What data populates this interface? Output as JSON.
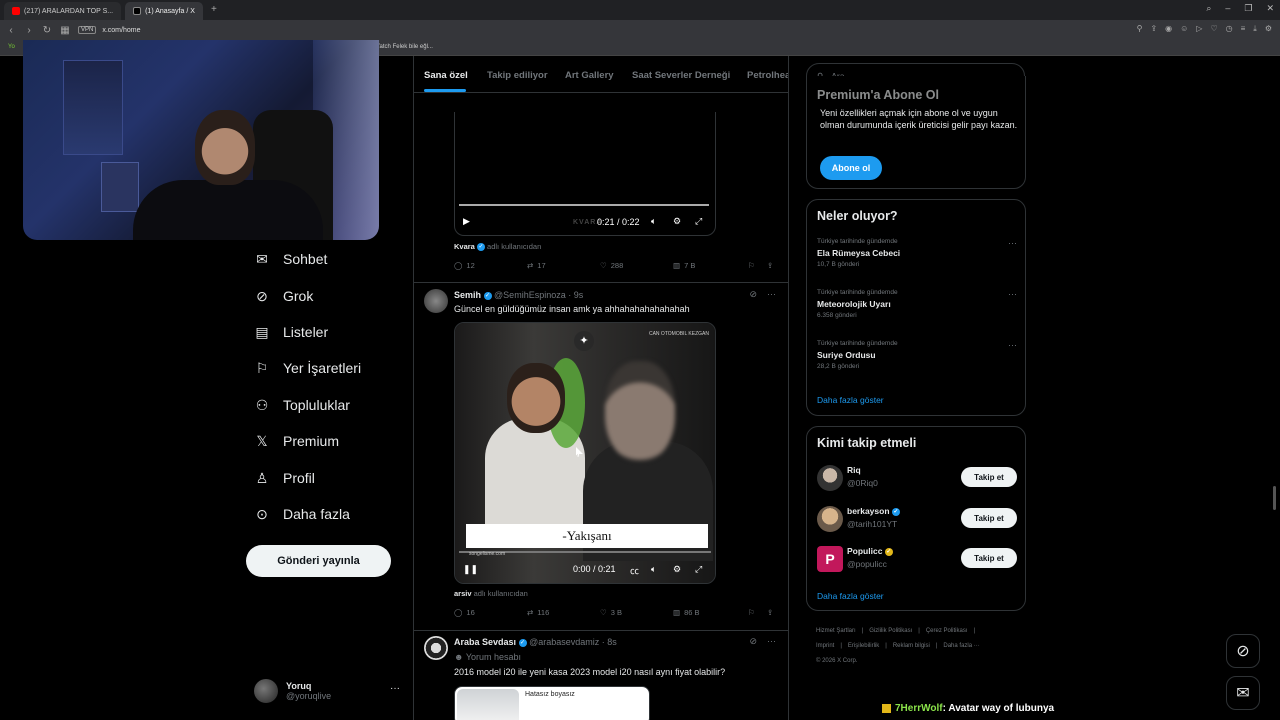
{
  "browser": {
    "tabs": [
      {
        "label": "(217) ARALARDAN TOP S...",
        "active": false
      },
      {
        "label": "(1) Anasayfa / X",
        "active": true
      }
    ],
    "url": "x.com/home",
    "vpn_badge": "VPN",
    "bookmark_left": "Yo",
    "bookmark_right": "Yatch Felek bile eğl..."
  },
  "sidebar": {
    "items": [
      {
        "label": "Sohbet",
        "icon": "mail-icon"
      },
      {
        "label": "Grok",
        "icon": "grok-icon"
      },
      {
        "label": "Listeler",
        "icon": "list-icon"
      },
      {
        "label": "Yer İşaretleri",
        "icon": "bookmark-icon"
      },
      {
        "label": "Topluluklar",
        "icon": "communities-icon"
      },
      {
        "label": "Premium",
        "icon": "x-logo-icon"
      },
      {
        "label": "Profil",
        "icon": "person-icon"
      },
      {
        "label": "Daha fazla",
        "icon": "more-circle-icon"
      }
    ],
    "post_button": "Gönderi yayınla",
    "account": {
      "name": "Yoruq",
      "handle": "@yoruqlive",
      "more": "···"
    }
  },
  "feed": {
    "tabs": [
      "Sana özel",
      "Takip ediliyor",
      "Art Gallery",
      "Saat Severler Derneği",
      "Petrolhea"
    ],
    "post1": {
      "video_time": "0:21 / 0:22",
      "watermark": "KVARA",
      "attribution_user": "Kvara",
      "attribution_suffix": "adlı kullanıcıdan",
      "replies": "12",
      "reposts": "17",
      "likes": "288",
      "views": "7 B"
    },
    "post2": {
      "name": "Semih",
      "handle": "@SemihEspinoza",
      "time": "· 9s",
      "text": "Güncel en güldüğümüz insan amk ya ahhahahahahahahah",
      "video_caption": "-Yakışanı",
      "video_site": "songelisme.com",
      "video_tag": "CAN OTOMOBIL KEZGAN",
      "video_time": "0:00 / 0:21",
      "attribution_user": "arsiv",
      "attribution_suffix": "adlı kullanıcıdan",
      "replies": "16",
      "reposts": "116",
      "likes": "3 B",
      "views": "86 B"
    },
    "post3": {
      "name": "Araba Sevdası",
      "handle": "@arabasevdamiz",
      "time": "· 8s",
      "subtitle": "Yorum hesabı",
      "text": "2016 model i20 ile yeni kasa 2023 model i20 nasıl aynı fiyat olabilir?",
      "card_text": "Hatasız boyasız"
    }
  },
  "right": {
    "search_placeholder": "Ara",
    "premium": {
      "title": "Premium'a Abone Ol",
      "text": "Yeni özellikleri açmak için abone ol ve uygun olman durumunda içerik üreticisi gelir payı kazan.",
      "button": "Abone ol"
    },
    "trends": {
      "title": "Neler oluyor?",
      "items": [
        {
          "meta": "Türkiye tarihinde gündemde",
          "name": "Ela Rümeysa Cebeci",
          "count": "10,7 B gönderi"
        },
        {
          "meta": "Türkiye tarihinde gündemde",
          "name": "Meteorolojik Uyarı",
          "count": "6.358 gönderi"
        },
        {
          "meta": "Türkiye tarihinde gündemde",
          "name": "Suriye Ordusu",
          "count": "28,2 B gönderi"
        }
      ],
      "more": "Daha fazla göster"
    },
    "who_to_follow": {
      "title": "Kimi takip etmeli",
      "items": [
        {
          "name": "Riq",
          "handle": "@0Riq0",
          "button": "Takip et"
        },
        {
          "name": "berkayson",
          "handle": "@tarih101YT",
          "button": "Takip et"
        },
        {
          "name": "Populicc",
          "handle": "@populicc",
          "button": "Takip et"
        }
      ],
      "more": "Daha fazla göster"
    },
    "footer": {
      "links": [
        "Hizmet Şartları",
        "|",
        "Gizlilik Politikası",
        "|",
        "Çerez Politikası",
        "|",
        "Imprint",
        "|",
        "Erişilebilirlik",
        "|",
        "Reklam bilgisi",
        "|",
        "Daha fazla ···"
      ],
      "copyright": "© 2026 X Corp."
    }
  },
  "chat_overlay": {
    "user": "7HerrWolf",
    "message": ": Avatar way of lubunya"
  },
  "colors": {
    "accent": "#1d9bf0",
    "background": "#000000",
    "text": "#e7e9ea",
    "muted": "#71767b",
    "border": "#2f3336"
  }
}
